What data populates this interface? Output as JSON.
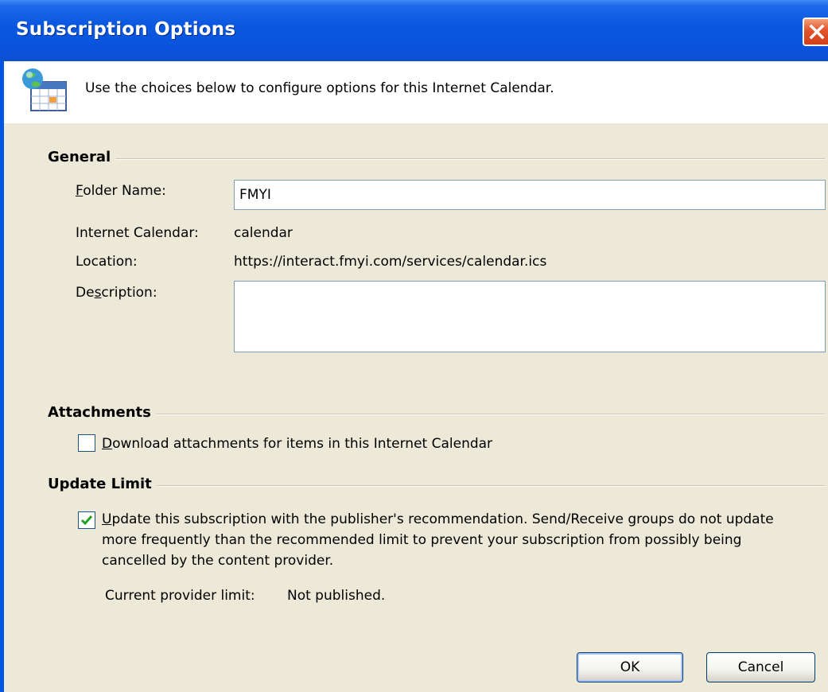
{
  "window": {
    "title": "Subscription Options"
  },
  "banner": {
    "text": "Use the choices below to configure options for this Internet Calendar."
  },
  "general": {
    "heading": "General",
    "folder_name_label_access": "F",
    "folder_name_label_rest": "older Name:",
    "folder_name_value": "FMYI",
    "internet_calendar_label": "Internet Calendar:",
    "internet_calendar_value": "calendar",
    "location_label": "Location:",
    "location_value": "https://interact.fmyi.com/services/calendar.ics",
    "description_label_pre": "De",
    "description_label_access": "s",
    "description_label_post": "cription:",
    "description_value": ""
  },
  "attachments": {
    "heading": "Attachments",
    "download_access": "D",
    "download_rest": "ownload attachments for items in this Internet Calendar",
    "download_checked": false
  },
  "update_limit": {
    "heading": "Update Limit",
    "update_access": "U",
    "update_rest": "pdate this subscription with the publisher's recommendation. Send/Receive groups do not update more frequently than the recommended limit to prevent your subscription from possibly being cancelled by the content provider.",
    "update_checked": true,
    "provider_limit_label": "Current provider limit:",
    "provider_limit_value": "Not published."
  },
  "buttons": {
    "ok": "OK",
    "cancel": "Cancel"
  },
  "colors": {
    "titlebar": "#0a55dd",
    "dialog_bg": "#ece9d8",
    "checkmark": "#21a121",
    "close": "#e2522b"
  },
  "icons": {
    "banner": "internet-calendar-icon",
    "close": "close-icon",
    "check": "checkmark-icon"
  }
}
